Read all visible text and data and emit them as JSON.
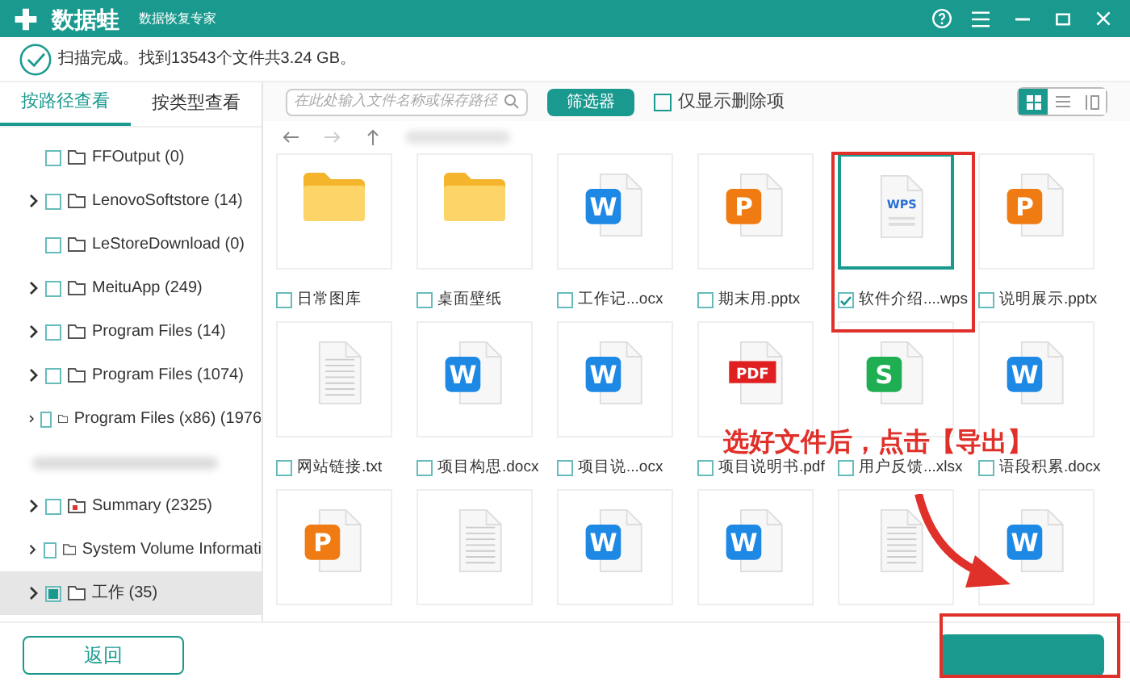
{
  "app": {
    "name": "数据蛙",
    "subtitle": "数据恢复专家"
  },
  "status": "扫描完成。找到13543个文件共3.24 GB。",
  "view_tabs": [
    {
      "label": "按路径查看",
      "selected": true
    },
    {
      "label": "按类型查看",
      "selected": false
    }
  ],
  "search": {
    "placeholder": "在此处输入文件名称或保存路径"
  },
  "filter_button": "筛选器",
  "deleted_only": {
    "label": "仅显示删除项",
    "checked": false
  },
  "view_modes": [
    {
      "kind": "grid",
      "selected": true
    },
    {
      "kind": "list",
      "selected": false
    },
    {
      "kind": "detail",
      "selected": false
    }
  ],
  "tree": [
    {
      "label": "FFOutput (0)",
      "expandable": false,
      "checked": false,
      "selected": false,
      "kind": "folder"
    },
    {
      "label": "LenovoSoftstore (14)",
      "expandable": true,
      "checked": false,
      "selected": false,
      "kind": "folder"
    },
    {
      "label": "LeStoreDownload (0)",
      "expandable": false,
      "checked": false,
      "selected": false,
      "kind": "folder"
    },
    {
      "label": "MeituApp (249)",
      "expandable": true,
      "checked": false,
      "selected": false,
      "kind": "folder"
    },
    {
      "label": "Program Files (14)",
      "expandable": true,
      "checked": false,
      "selected": false,
      "kind": "folder"
    },
    {
      "label": "Program Files (1074)",
      "expandable": true,
      "checked": false,
      "selected": false,
      "kind": "folder"
    },
    {
      "label": "Program Files (x86) (1976",
      "expandable": true,
      "checked": false,
      "selected": false,
      "kind": "folder"
    },
    {
      "kind": "blurred"
    },
    {
      "label": "Summary (2325)",
      "expandable": true,
      "checked": false,
      "selected": false,
      "kind": "folder-red"
    },
    {
      "label": "System Volume Informati",
      "expandable": true,
      "checked": false,
      "selected": false,
      "kind": "folder"
    },
    {
      "label": "工作 (35)",
      "expandable": true,
      "checked": true,
      "selected": true,
      "kind": "folder"
    }
  ],
  "files": [
    {
      "kind": "folder",
      "name": "日常图库",
      "checked": false
    },
    {
      "kind": "folder",
      "name": "桌面壁纸",
      "checked": false
    },
    {
      "kind": "word",
      "badge": "W",
      "name": "工作记...ocx",
      "checked": false
    },
    {
      "kind": "ppt",
      "badge": "P",
      "name": "期末用.pptx",
      "checked": false
    },
    {
      "kind": "wps",
      "badge": "WPS",
      "name": "软件介绍....wps",
      "checked": true
    },
    {
      "kind": "ppt",
      "badge": "P",
      "name": "说明展示.pptx",
      "checked": false
    },
    {
      "kind": "text",
      "name": "网站链接.txt",
      "checked": false
    },
    {
      "kind": "word",
      "badge": "W",
      "name": "项目构思.docx",
      "checked": false
    },
    {
      "kind": "word",
      "badge": "W",
      "name": "项目说...ocx",
      "checked": false
    },
    {
      "kind": "pdf",
      "badge": "PDF",
      "name": "项目说明书.pdf",
      "checked": false
    },
    {
      "kind": "excel",
      "badge": "S",
      "name": "用户反馈...xlsx",
      "checked": false
    },
    {
      "kind": "word",
      "badge": "W",
      "name": "语段积累.docx",
      "checked": false
    },
    {
      "kind": "ppt",
      "badge": "P"
    },
    {
      "kind": "text"
    },
    {
      "kind": "word",
      "badge": "W"
    },
    {
      "kind": "word",
      "badge": "W"
    },
    {
      "kind": "text"
    },
    {
      "kind": "word",
      "badge": "W"
    }
  ],
  "back_button": "返回",
  "annotation": "选好文件后，点击【导出】"
}
